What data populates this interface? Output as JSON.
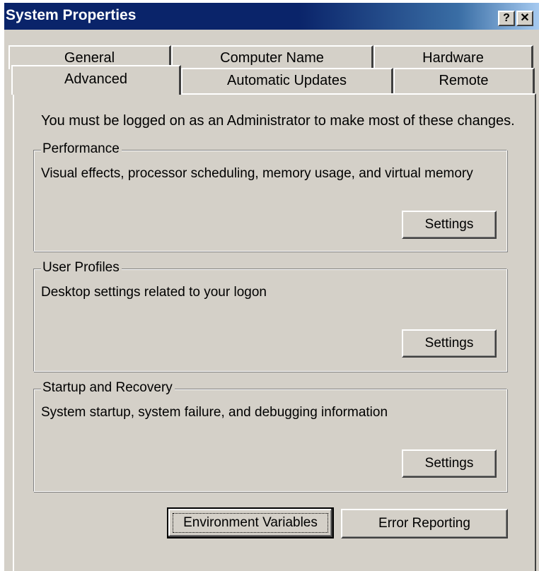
{
  "window": {
    "title": "System Properties",
    "help_glyph": "?",
    "close_glyph": "✕"
  },
  "tabs": {
    "row1": [
      "General",
      "Computer Name",
      "Hardware"
    ],
    "row2": [
      "Advanced",
      "Automatic Updates",
      "Remote"
    ],
    "active": "Advanced"
  },
  "notice": "You must be logged on as an Administrator to make most of these changes.",
  "groups": {
    "performance": {
      "label": "Performance",
      "description": "Visual effects, processor scheduling, memory usage, and virtual memory",
      "button": "Settings"
    },
    "user_profiles": {
      "label": "User Profiles",
      "description": "Desktop settings related to your logon",
      "button": "Settings"
    },
    "startup_recovery": {
      "label": "Startup and Recovery",
      "description": "System startup, system failure, and debugging information",
      "button": "Settings"
    }
  },
  "buttons": {
    "environment_variables": "Environment Variables",
    "error_reporting": "Error Reporting"
  },
  "colors": {
    "titlebar": "#0a246a",
    "face": "#d4d0c8"
  }
}
